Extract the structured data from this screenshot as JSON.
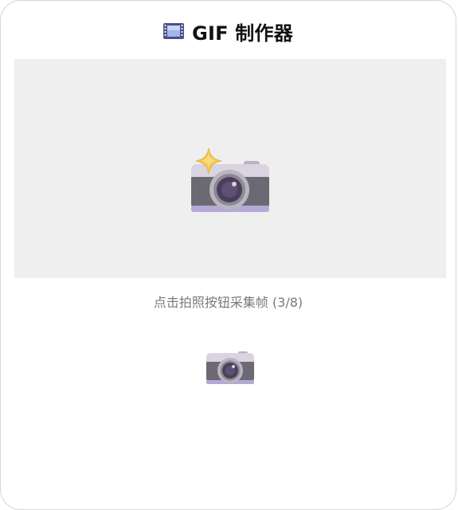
{
  "header": {
    "icon": "film-frames-icon",
    "title": "GIF 制作器"
  },
  "preview": {
    "icon": "camera-with-flash-icon"
  },
  "status": {
    "text": "点击拍照按钮采集帧 (3/8)"
  },
  "controls": {
    "shutter_icon": "camera-icon"
  },
  "colors": {
    "preview_bg": "#efefef",
    "status_text": "#7a7a7a",
    "title_text": "#111111"
  }
}
